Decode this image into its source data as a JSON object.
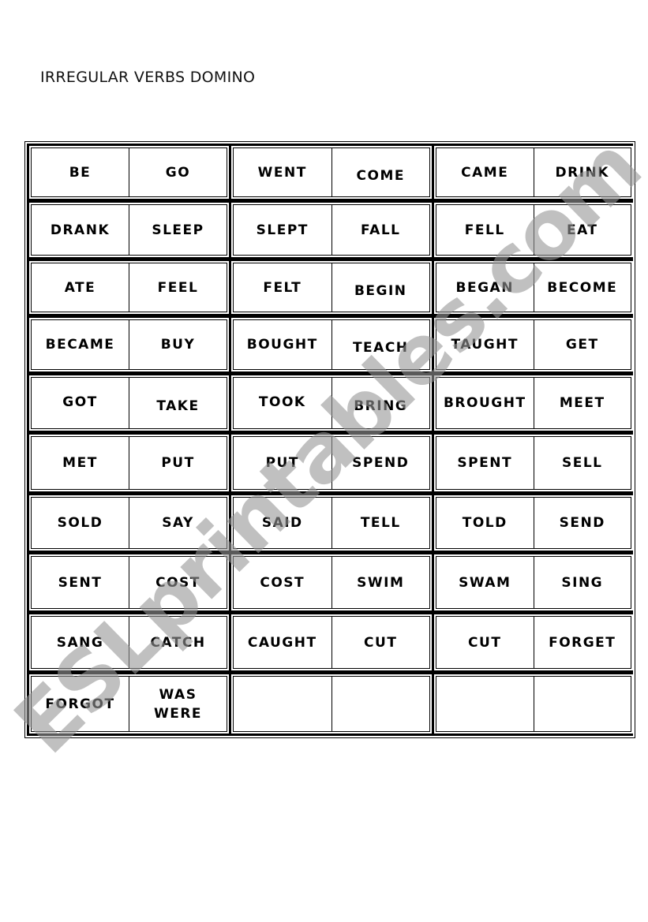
{
  "document": {
    "title": "IRREGULAR VERBS DOMINO",
    "watermark": "ESLprintables.com"
  },
  "dominoes": [
    {
      "left": "BE",
      "right": "GO"
    },
    {
      "left": "WENT",
      "right": "COME"
    },
    {
      "left": "CAME",
      "right": "DRINK"
    },
    {
      "left": "DRANK",
      "right": "SLEEP"
    },
    {
      "left": "SLEPT",
      "right": "FALL"
    },
    {
      "left": "FELL",
      "right": "EAT"
    },
    {
      "left": "ATE",
      "right": "FEEL"
    },
    {
      "left": "FELT",
      "right": "BEGIN"
    },
    {
      "left": "BEGAN",
      "right": "BECOME"
    },
    {
      "left": "BECAME",
      "right": "BUY"
    },
    {
      "left": "BOUGHT",
      "right": "TEACH"
    },
    {
      "left": "TAUGHT",
      "right": "GET"
    },
    {
      "left": "GOT",
      "right": "TAKE"
    },
    {
      "left": "TOOK",
      "right": "BRING"
    },
    {
      "left": "BROUGHT",
      "right": "MEET"
    },
    {
      "left": "MET",
      "right": "PUT"
    },
    {
      "left": "PUT",
      "right": "SPEND"
    },
    {
      "left": "SPENT",
      "right": "SELL"
    },
    {
      "left": "SOLD",
      "right": "SAY"
    },
    {
      "left": "SAID",
      "right": "TELL"
    },
    {
      "left": "TOLD",
      "right": "SEND"
    },
    {
      "left": "SENT",
      "right": "COST"
    },
    {
      "left": "COST",
      "right": "SWIM"
    },
    {
      "left": "SWAM",
      "right": "SING"
    },
    {
      "left": "SANG",
      "right": "CATCH"
    },
    {
      "left": "CAUGHT",
      "right": "CUT"
    },
    {
      "left": "CUT",
      "right": "FORGET"
    },
    {
      "left": "FORGOT",
      "right": "WAS\nWERE"
    },
    {
      "left": "",
      "right": ""
    },
    {
      "left": "",
      "right": ""
    }
  ]
}
